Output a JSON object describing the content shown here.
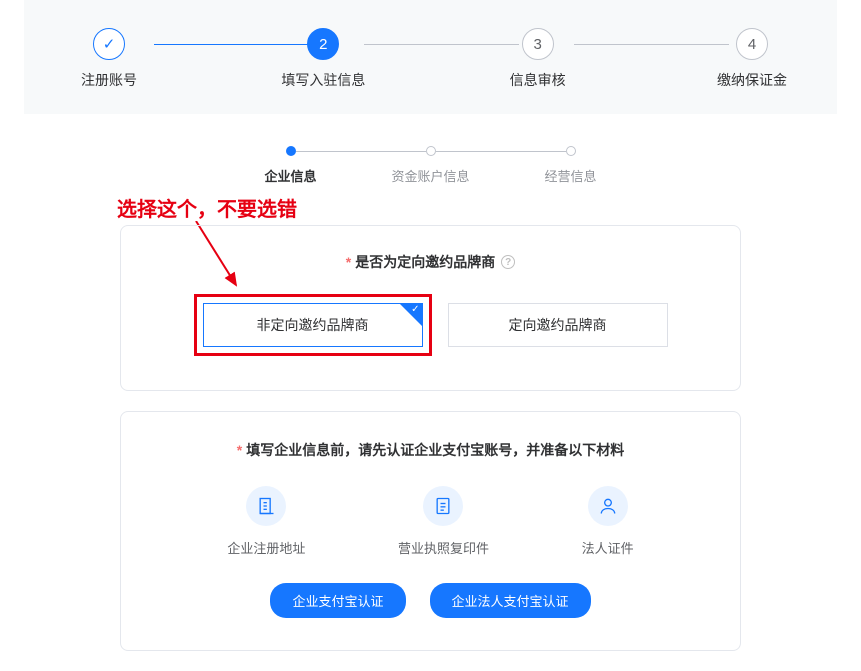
{
  "stepper": {
    "steps": [
      {
        "label": "注册账号",
        "state": "completed",
        "mark": "✓"
      },
      {
        "label": "填写入驻信息",
        "state": "active",
        "mark": "2"
      },
      {
        "label": "信息审核",
        "state": "pending",
        "mark": "3"
      },
      {
        "label": "缴纳保证金",
        "state": "pending",
        "mark": "4"
      }
    ]
  },
  "sub_stepper": {
    "items": [
      {
        "label": "企业信息",
        "state": "active"
      },
      {
        "label": "资金账户信息",
        "state": "inactive"
      },
      {
        "label": "经营信息",
        "state": "inactive"
      }
    ]
  },
  "annotation": {
    "text": "选择这个，不要选错"
  },
  "brand_question": {
    "required_mark": "*",
    "text": "是否为定向邀约品牌商",
    "help": "?",
    "options": [
      {
        "label": "非定向邀约品牌商",
        "selected": true
      },
      {
        "label": "定向邀约品牌商",
        "selected": false
      }
    ]
  },
  "info_section": {
    "required_mark": "*",
    "title": "填写企业信息前，请先认证企业支付宝账号，并准备以下材料",
    "items": [
      {
        "icon": "building-icon",
        "label": "企业注册地址"
      },
      {
        "icon": "document-icon",
        "label": "营业执照复印件"
      },
      {
        "icon": "person-icon",
        "label": "法人证件"
      }
    ],
    "buttons": [
      {
        "label": "企业支付宝认证"
      },
      {
        "label": "企业法人支付宝认证"
      }
    ]
  }
}
